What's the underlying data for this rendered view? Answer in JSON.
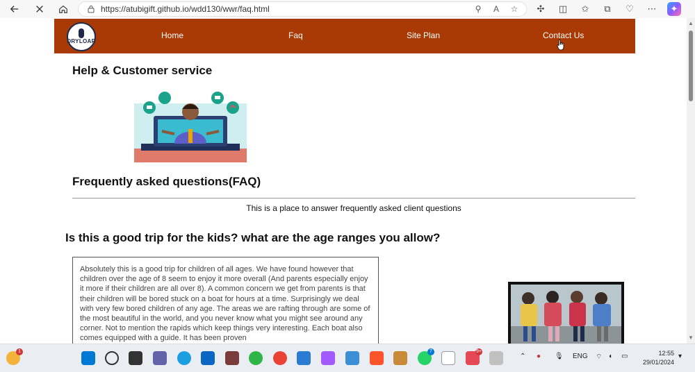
{
  "browser": {
    "url": "https://atubigift.github.io/wdd130/wwr/faq.html"
  },
  "site": {
    "logo_text": "DRYLOAR",
    "nav": [
      {
        "label": "Home"
      },
      {
        "label": "Faq"
      },
      {
        "label": "Site Plan"
      },
      {
        "label": "Contact Us"
      }
    ],
    "help_title": "Help & Customer service",
    "faq_title": "Frequently asked questions(FAQ)",
    "faq_subtitle": "This is a place to answer frequently asked client questions",
    "question": "Is this a good trip for the kids? what are the age ranges you allow?",
    "answer": "Absolutely this is a good trip for children of all ages. We have found however that children over the age of 8 seem to enjoy it more overall (And parents especially enjoy it more if their children are all over 8). A common concern we get from parents is that their children will be bored stuck on a boat for hours at a time. Surprisingly we deal with very few bored children of any age. The areas we are rafting through are some of the most beautiful in the world, and you never know what you might see around any corner. Not to mention the rapids which keep things very interesting. Each boat also comes equipped with a guide. It has been proven"
  },
  "taskbar": {
    "weather_badge": "1",
    "badges": {
      "teams": "7",
      "whatsapp": "9+"
    },
    "lang": "ENG",
    "time": "12:55",
    "date": "29/01/2024"
  },
  "colors": {
    "nav_bg": "#a93a05",
    "text": "#111111"
  }
}
